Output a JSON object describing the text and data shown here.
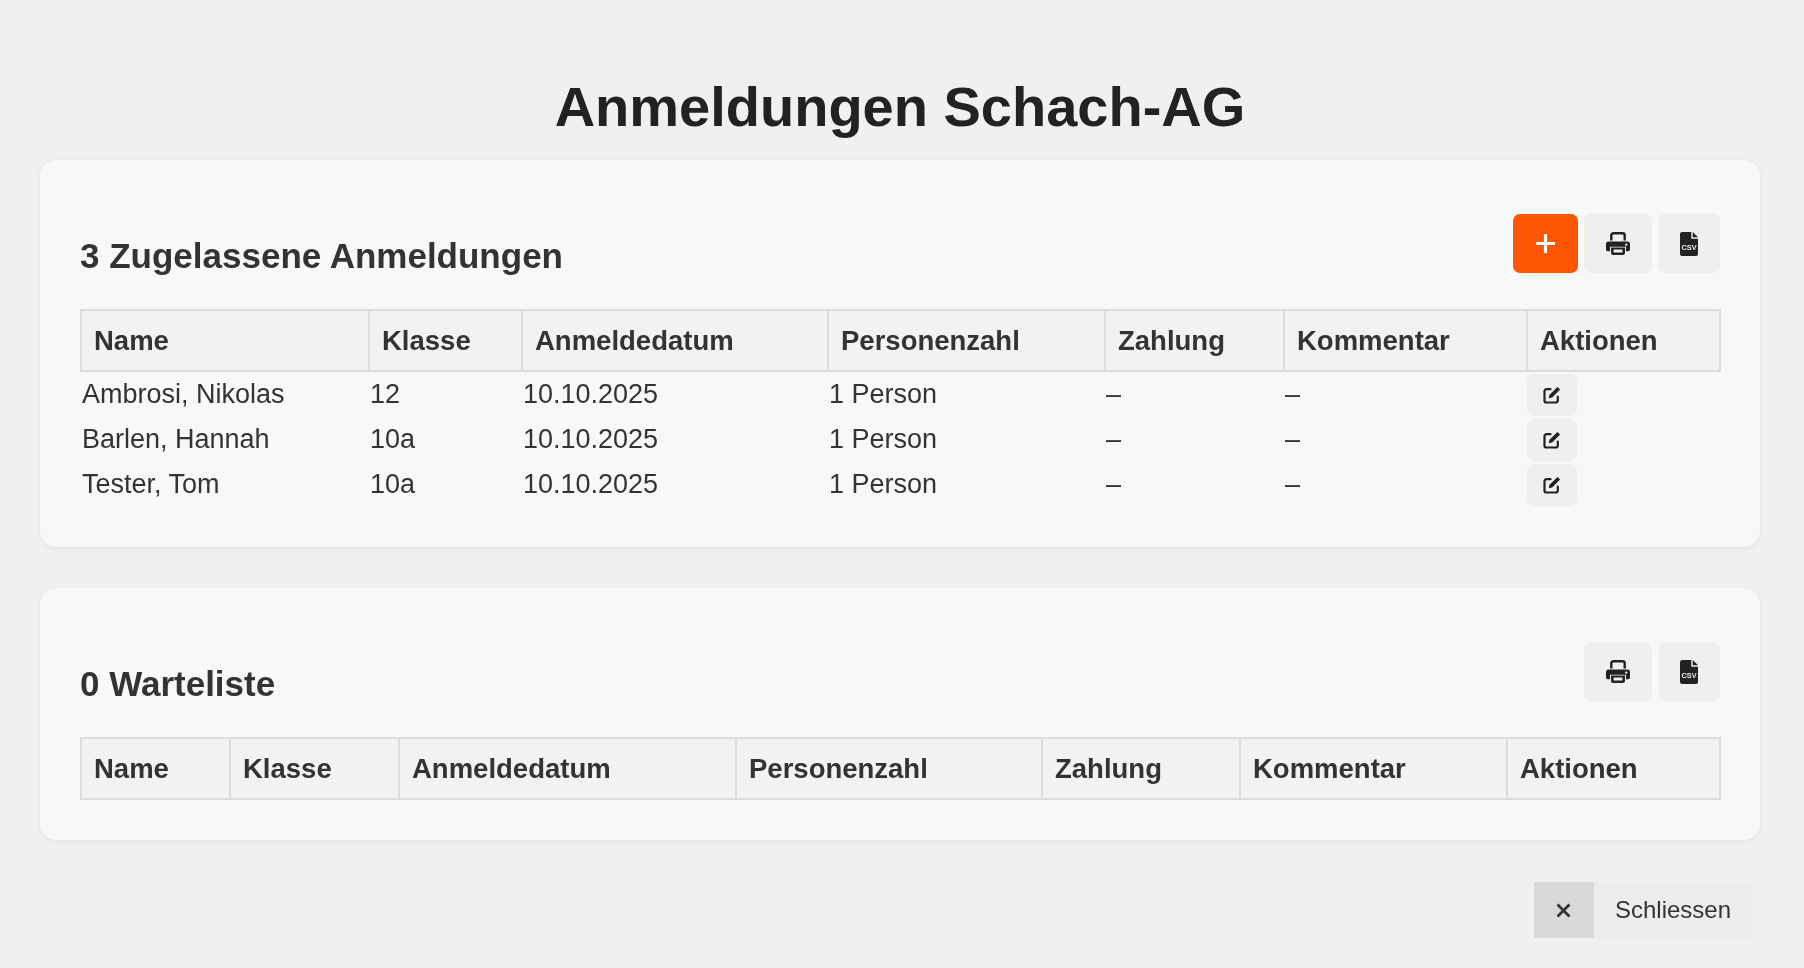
{
  "title": "Anmeldungen Schach-AG",
  "sections": [
    {
      "heading": "3 Zugelassene Anmeldungen",
      "toolbar": [
        {
          "kind": "add"
        },
        {
          "kind": "print"
        },
        {
          "kind": "csv",
          "icon_text": "CSV"
        }
      ],
      "table": {
        "columns": [
          "Name",
          "Klasse",
          "Anmeldedatum",
          "Personenzahl",
          "Zahlung",
          "Kommentar",
          "Aktionen"
        ],
        "rows": [
          {
            "cells": [
              "Ambrosi, Nikolas",
              "12",
              "10.10.2025",
              "1 Person",
              "–",
              "–"
            ],
            "actions": [
              {
                "kind": "edit"
              }
            ]
          },
          {
            "cells": [
              "Barlen, Hannah",
              "10a",
              "10.10.2025",
              "1 Person",
              "–",
              "–"
            ],
            "actions": [
              {
                "kind": "edit"
              }
            ]
          },
          {
            "cells": [
              "Tester, Tom",
              "10a",
              "10.10.2025",
              "1 Person",
              "–",
              "–"
            ],
            "actions": [
              {
                "kind": "edit"
              }
            ]
          }
        ]
      }
    },
    {
      "heading": "0 Warteliste",
      "toolbar": [
        {
          "kind": "print"
        },
        {
          "kind": "csv",
          "icon_text": "CSV"
        }
      ],
      "table": {
        "columns": [
          "Name",
          "Klasse",
          "Anmeldedatum",
          "Personenzahl",
          "Zahlung",
          "Kommentar",
          "Aktionen"
        ]
      }
    }
  ],
  "close_button": {
    "label": "Schliessen"
  }
}
